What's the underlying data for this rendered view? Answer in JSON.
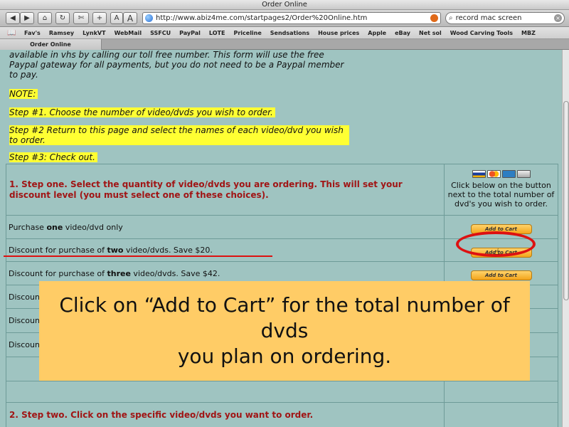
{
  "window": {
    "title": "Order Online"
  },
  "toolbar": {
    "back_icon": "back-arrow-icon",
    "forward_icon": "forward-arrow-icon",
    "url": "http://www.abiz4me.com/startpages2/Order%20Online.htm",
    "search_value": "record mac screen",
    "small_a": "A",
    "large_a": "A",
    "plus": "+"
  },
  "bookmarks": [
    "Fav's",
    "Ramsey",
    "LynkVT",
    "WebMail",
    "SSFCU",
    "PayPal",
    "LOTE",
    "Priceline",
    "Sendsations",
    "House prices",
    "Apple",
    "eBay",
    "Net sol",
    "Wood Carving Tools",
    "MBZ"
  ],
  "tab": {
    "label": "Order Online"
  },
  "page": {
    "intro": "available in vhs by calling our toll free number. This form will use the free Paypal gateway for all payments, but you do not need to be a Paypal member to pay.",
    "note": "NOTE:",
    "step1": "Step #1. Choose the number of video/dvds you wish to order.",
    "step2": "Step #2 Return to this page and select the names of each video/dvd you wish to order.",
    "step3": "Step #3: Check out.",
    "table": {
      "step_one_heading": "1. Step one. Select the quantity of video/dvds you are ordering. This will set your discount level (you must select one of these choices).",
      "right_note": "Click below on the button next to the total number of dvd's you wish to order.",
      "rows": [
        {
          "pre": "Purchase ",
          "bold": "one",
          "post": " video/dvd only"
        },
        {
          "pre": "Discount for purchase of ",
          "bold": "two",
          "post": " video/dvds. Save $20."
        },
        {
          "pre": "Discount for purchase of ",
          "bold": "three",
          "post": " video/dvds. Save $42."
        },
        {
          "pre": "Discoun",
          "bold": "",
          "post": ""
        },
        {
          "pre": "Discoun",
          "bold": "",
          "post": ""
        },
        {
          "pre": "Discoun",
          "bold": "",
          "post": ""
        }
      ],
      "add_to_cart": "Add to Cart",
      "step_two_heading": "2. Step two. Click on the specific video/dvds you want to order."
    }
  },
  "callout": {
    "line1": "Click on “Add to Cart” for the total number of dvds",
    "line2": "you plan on ordering."
  },
  "colors": {
    "page_bg": "#9fc4c1",
    "highlight": "#ffff33",
    "heading_red": "#a01515",
    "callout_bg": "#ffcc66",
    "annotation_red": "#dd1111"
  }
}
